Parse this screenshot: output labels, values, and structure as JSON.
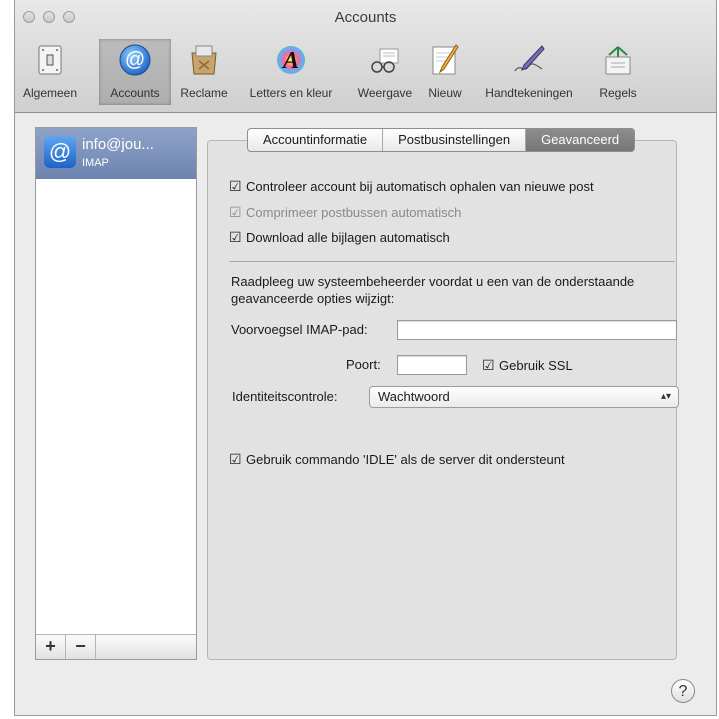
{
  "window": {
    "title": "Accounts"
  },
  "toolbar": {
    "items": [
      {
        "label": "Algemeen",
        "icon": "switch-icon"
      },
      {
        "label": "Accounts",
        "icon": "at-sign-icon"
      },
      {
        "label": "Reclame",
        "icon": "junk-mail-icon"
      },
      {
        "label": "Letters en kleur",
        "icon": "font-color-icon"
      },
      {
        "label": "Weergave",
        "icon": "glasses-icon"
      },
      {
        "label": "Nieuw",
        "icon": "compose-icon"
      },
      {
        "label": "Handtekeningen",
        "icon": "signature-pen-icon"
      },
      {
        "label": "Regels",
        "icon": "rules-icon"
      }
    ],
    "selected": "Accounts"
  },
  "sidebar": {
    "accounts": [
      {
        "name": "info@jou...",
        "type": "IMAP"
      }
    ],
    "add_label": "+",
    "remove_label": "−"
  },
  "tabs": {
    "items": [
      "Accountinformatie",
      "Postbusinstellingen",
      "Geavanceerd"
    ],
    "active": "Geavanceerd"
  },
  "advanced": {
    "check_auto_fetch": {
      "label": "Controleer account bij automatisch ophalen van nieuwe post",
      "checked": true,
      "enabled": true
    },
    "compress_mailboxes": {
      "label": "Comprimeer postbussen automatisch",
      "checked": true,
      "enabled": false
    },
    "download_attachments": {
      "label": "Download alle bijlagen automatisch",
      "checked": true,
      "enabled": true
    },
    "note": "Raadpleeg uw systeembeheerder voordat u een van de onderstaande geavanceerde opties wijzigt:",
    "imap_prefix_label": "Voorvoegsel IMAP-pad:",
    "imap_prefix_value": "",
    "port_label": "Poort:",
    "port_value": "",
    "use_ssl": {
      "label": "Gebruik SSL",
      "checked": true
    },
    "auth_label": "Identiteitscontrole:",
    "auth_value": "Wachtwoord",
    "idle": {
      "label": "Gebruik commando 'IDLE' als de server dit ondersteunt",
      "checked": true
    }
  },
  "help_label": "?",
  "colors": {
    "selection": "#7a8fb8",
    "active_tab": "#7f7f7f",
    "window_bg": "#ececec"
  }
}
